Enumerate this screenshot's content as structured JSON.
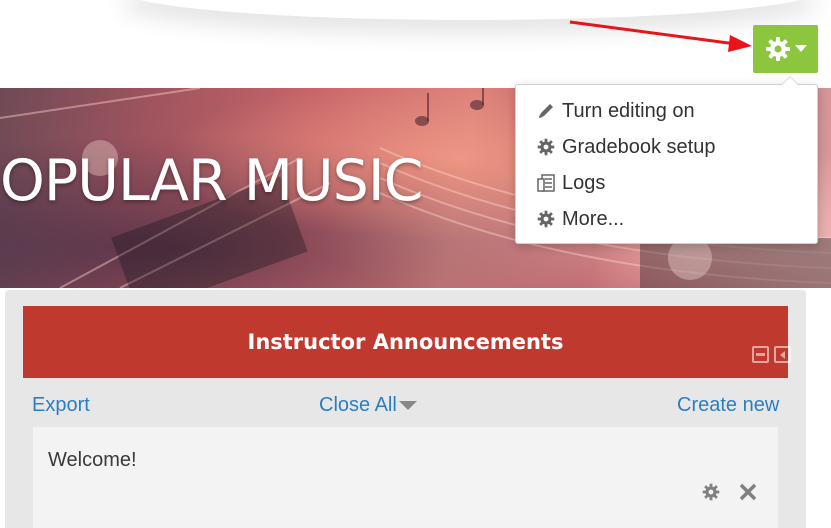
{
  "header": {
    "gear_button_icon": "gear-icon",
    "dropdown_icon": "caret-down-icon",
    "accent_color": "#8cc63e"
  },
  "banner": {
    "title": "OPULAR MUSIC"
  },
  "menu": {
    "items": [
      {
        "label": "Turn editing on",
        "icon": "pencil-icon"
      },
      {
        "label": "Gradebook setup",
        "icon": "gear-icon"
      },
      {
        "label": "Logs",
        "icon": "report-icon"
      },
      {
        "label": "More...",
        "icon": "gear-icon"
      }
    ]
  },
  "block": {
    "title": "Instructor Announcements",
    "header_color": "#c0392f",
    "links": {
      "export": "Export",
      "close_all": "Close All",
      "create_new": "Create new"
    },
    "posts": [
      {
        "text": "Welcome!"
      }
    ]
  }
}
